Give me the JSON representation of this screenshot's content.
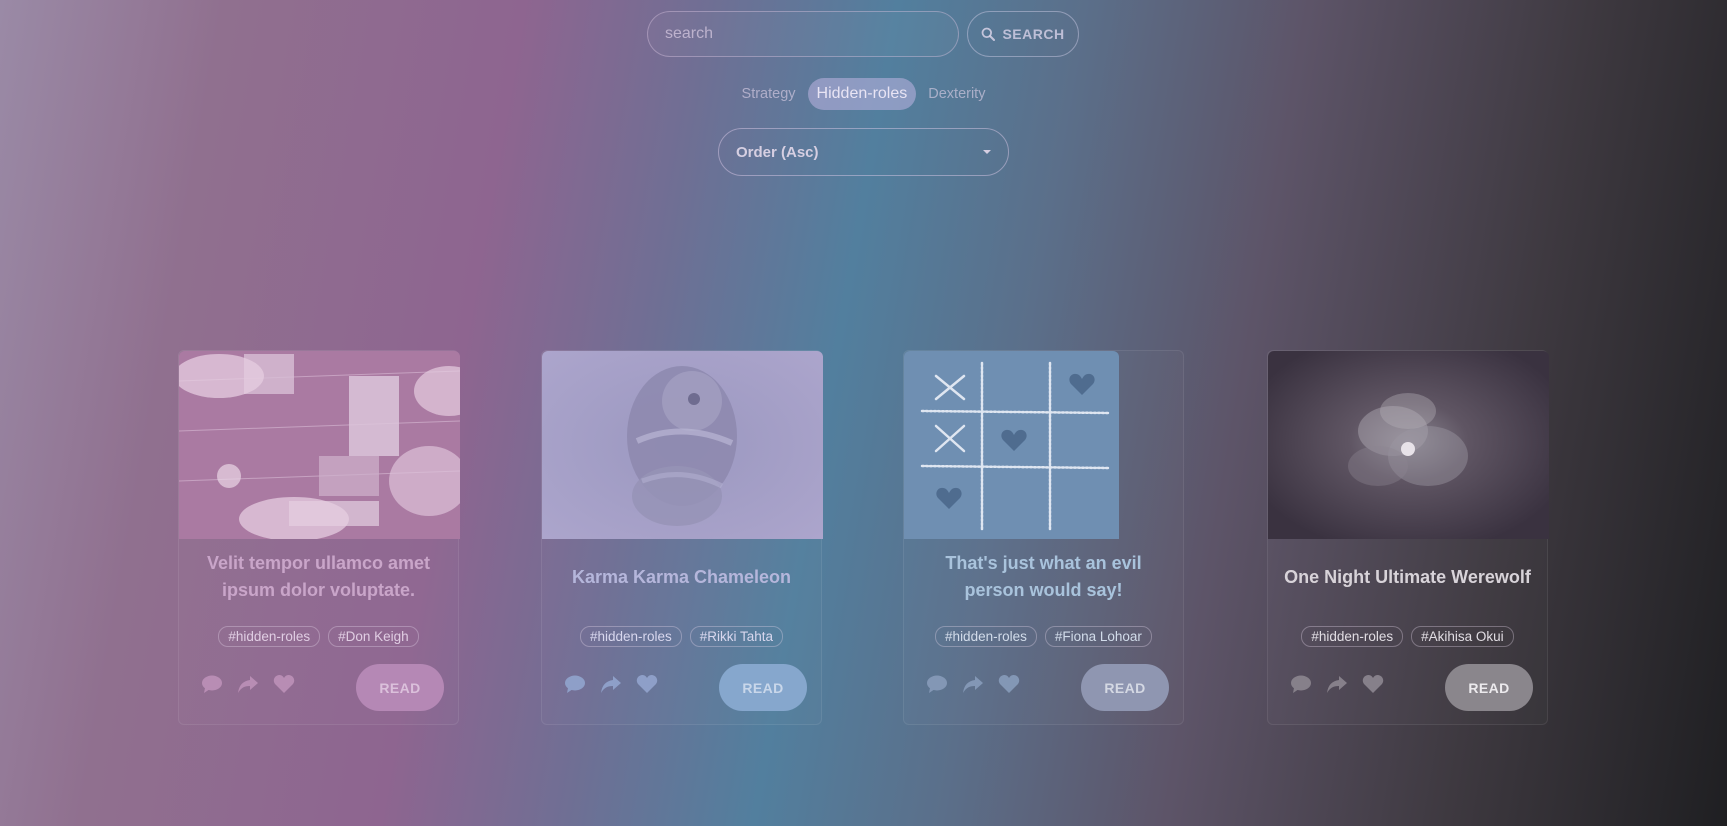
{
  "search": {
    "placeholder": "search",
    "button_label": "SEARCH"
  },
  "filters": [
    {
      "label": "Strategy",
      "active": false
    },
    {
      "label": "Hidden-roles",
      "active": true
    },
    {
      "label": "Dexterity",
      "active": false
    }
  ],
  "order": {
    "selected": "Order (Asc)"
  },
  "cards": [
    {
      "title": "Velit tempor ullamco amet ipsum dolor voluptate.",
      "tags": [
        "#hidden-roles",
        "#Don Keigh"
      ],
      "read_label": "READ",
      "image": "board-game-players-photo",
      "accent": "#c7a3c7"
    },
    {
      "title": "Karma Karma Chameleon",
      "tags": [
        "#hidden-roles",
        "#Rikki Tahta"
      ],
      "read_label": "READ",
      "image": "chameleon-photo",
      "accent": "#b3b5da"
    },
    {
      "title": "That's just what an evil person would say!",
      "tags": [
        "#hidden-roles",
        "#Fiona Lohoar"
      ],
      "read_label": "READ",
      "image": "tic-tac-toe-hearts-photo",
      "accent": "#a5c3dc"
    },
    {
      "title": "One Night Ultimate Werewolf",
      "tags": [
        "#hidden-roles",
        "#Akihisa Okui"
      ],
      "read_label": "READ",
      "image": "moon-clouds-photo",
      "accent": "#d8d2d8"
    }
  ]
}
